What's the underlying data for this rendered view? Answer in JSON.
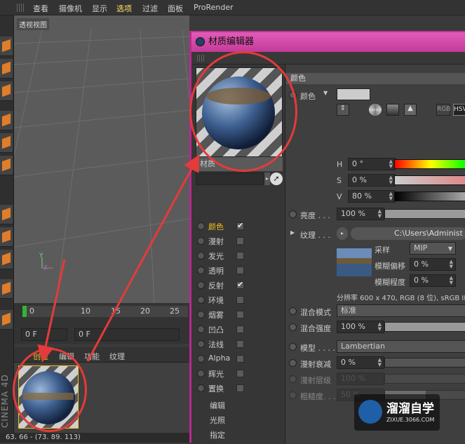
{
  "menubar": {
    "items": [
      "查看",
      "摄像机",
      "显示",
      "选项",
      "过滤",
      "面板",
      "ProRender"
    ],
    "selected_index": 3
  },
  "viewport": {
    "label": "透视视图"
  },
  "timeline": {
    "ticks": [
      "0",
      "10",
      "15",
      "20",
      "25"
    ],
    "frame_field": "0 F",
    "frame_field2": "0 F"
  },
  "material_manager": {
    "menu": [
      "创建",
      "编辑",
      "功能",
      "纹理"
    ],
    "active_menu_index": 0
  },
  "status_bar": "63. 66 - (73. 89. 113)",
  "c4d_logo": "CINEMA 4D",
  "editor": {
    "title": "材质编辑器",
    "material_name": "材质",
    "channels": [
      {
        "label": "颜色",
        "checked": true,
        "active": true
      },
      {
        "label": "漫射",
        "checked": false
      },
      {
        "label": "发光",
        "checked": false
      },
      {
        "label": "透明",
        "checked": false
      },
      {
        "label": "反射",
        "checked": true
      },
      {
        "label": "环境",
        "checked": false
      },
      {
        "label": "烟雾",
        "checked": false
      },
      {
        "label": "凹凸",
        "checked": false
      },
      {
        "label": "法线",
        "checked": false
      },
      {
        "label": "Alpha",
        "checked": false
      },
      {
        "label": "辉光",
        "checked": false
      },
      {
        "label": "置换",
        "checked": false
      }
    ],
    "sub_links": [
      "编辑",
      "光照",
      "指定"
    ],
    "right": {
      "section_title": "颜色",
      "color_label": "颜色",
      "color_mode_buttons": [
        "RGB",
        "HSV"
      ],
      "h_label": "H",
      "h_value": "0 °",
      "s_label": "S",
      "s_value": "0 %",
      "v_label": "V",
      "v_value": "80 %",
      "brightness_label": "亮度 . . .",
      "brightness_value": "100 %",
      "brightness_level": 1.0,
      "texture_label": "纹理 . . .",
      "texture_path": "C:\\Users\\Administ",
      "sampling_label": "采样",
      "sampling_value": "MIP",
      "blur_offset_label": "模糊偏移",
      "blur_offset_value": "0 %",
      "blur_scale_label": "模糊程度",
      "blur_scale_value": "0 %",
      "resolution_text": "分辨率 600 x 470, RGB (8 位), sRGB IE",
      "mix_mode_label": "混合模式",
      "mix_mode_value": "标准",
      "mix_strength_label": "混合强度",
      "mix_strength_value": "100 %",
      "mix_strength_level": 1.0,
      "model_label": "模型 . . . .",
      "model_value": "Lambertian",
      "diffuse_falloff_label": "漫射衰减",
      "diffuse_falloff_value": "0 %",
      "diffuse_level_label": "漫射层级",
      "diffuse_level_value": "100 %",
      "roughness_label": "粗糙度. . .",
      "roughness_value": "50 %",
      "roughness_level": 0.5
    }
  },
  "watermark": {
    "title": "溜溜自学",
    "url": "ZIXUE.3066.COM"
  },
  "colors": {
    "accent_pink": "#c33b98",
    "active_yellow": "#f0c020",
    "annotation_red": "#e53a3a"
  }
}
